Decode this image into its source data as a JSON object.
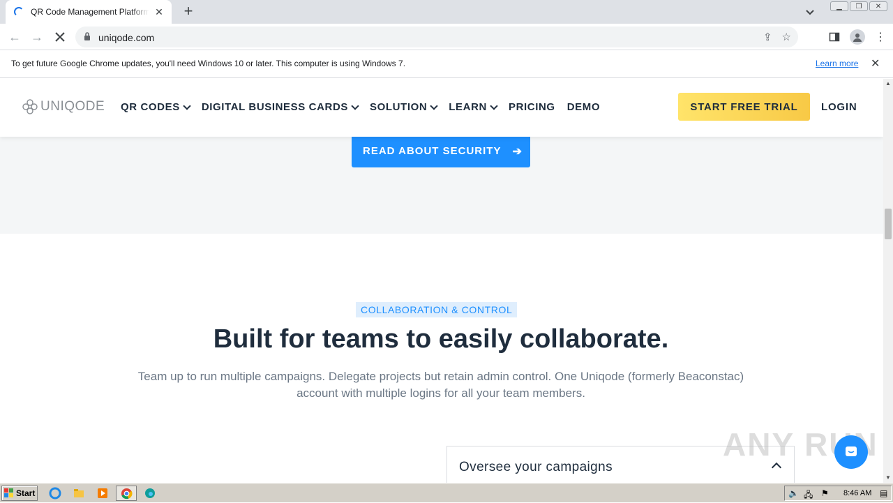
{
  "browser": {
    "tab_title": "QR Code Management Platform for n",
    "url": "uniqode.com",
    "infobar_text": "To get future Google Chrome updates, you'll need Windows 10 or later. This computer is using Windows 7.",
    "infobar_link": "Learn more"
  },
  "site": {
    "logo_text": "UNIQODE",
    "nav": [
      {
        "label": "QR CODES",
        "dropdown": true
      },
      {
        "label": "DIGITAL BUSINESS CARDS",
        "dropdown": true
      },
      {
        "label": "SOLUTION",
        "dropdown": true
      },
      {
        "label": "LEARN",
        "dropdown": true
      },
      {
        "label": "PRICING",
        "dropdown": false
      },
      {
        "label": "DEMO",
        "dropdown": false
      }
    ],
    "trial_button": "START FREE TRIAL",
    "login": "LOGIN"
  },
  "content": {
    "security_button": "READ ABOUT SECURITY",
    "badge": "COLLABORATION & CONTROL",
    "headline": "Built for teams to easily collaborate.",
    "subtext": "Team up to run multiple campaigns. Delegate projects but retain admin control. One Uniqode (formerly Beaconstac) account with multiple logins for all your team members.",
    "accordion_title": "Oversee your campaigns"
  },
  "watermark": "ANY RUN",
  "taskbar": {
    "start_label": "Start",
    "clock": "8:46 AM"
  },
  "colors": {
    "primary_blue": "#1e90ff",
    "trial_yellow": "#f8c946",
    "text_dark": "#1f2d3d"
  }
}
